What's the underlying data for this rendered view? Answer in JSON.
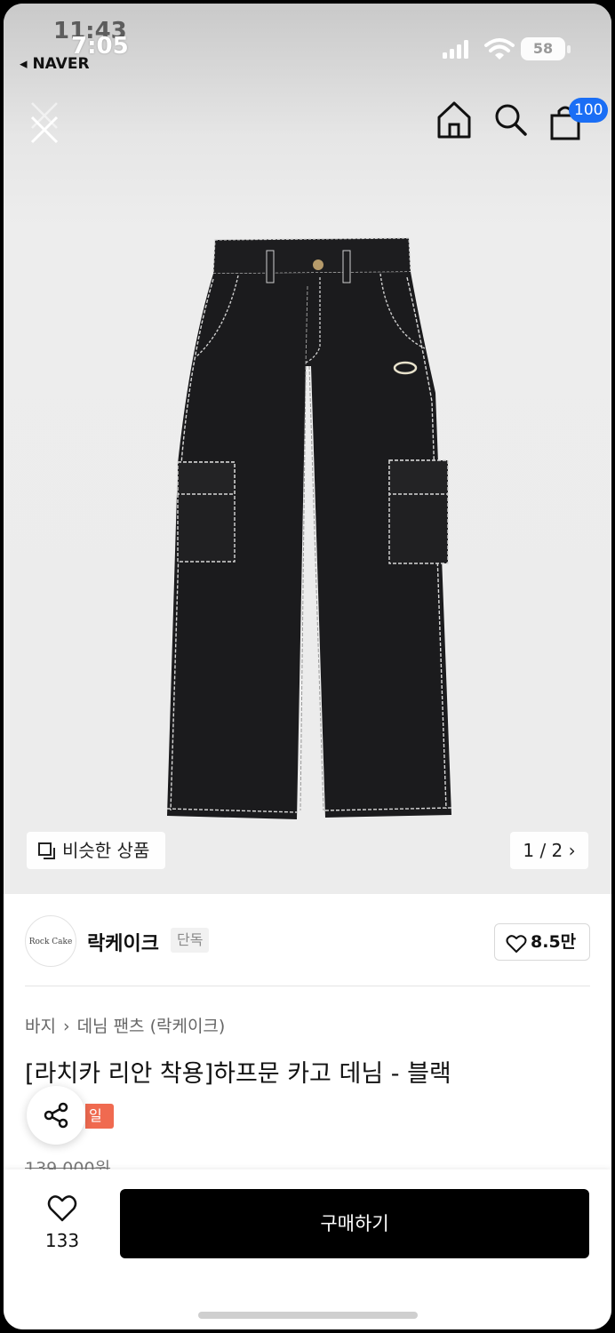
{
  "status_bar": {
    "time_ghost": "11:43",
    "time": "7:05",
    "back_app": "◂ NAVER",
    "battery": "58"
  },
  "header": {
    "cart_badge": "100"
  },
  "image": {
    "similar_label": "비슷한 상품",
    "counter": "1 / 2 ›"
  },
  "brand": {
    "logo_text": "Rock Cake",
    "name": "락케이크",
    "exclusive_badge": "단독",
    "like_count": "8.5만"
  },
  "product": {
    "breadcrumb": [
      "바지",
      "데님 팬츠 (락케이크)"
    ],
    "breadcrumb_separator": "›",
    "title": "[라치카 리안 착용]하프문 카고 데님 - 블랙",
    "sale_badge": "일",
    "original_price": "139,000원"
  },
  "bottom_bar": {
    "wish_count": "133",
    "buy_label": "구매하기"
  },
  "colors": {
    "cart_badge": "#1a6ef5",
    "buy_button": "#000000",
    "sale_badge": "#f06a50"
  },
  "icons": [
    "close-icon",
    "home-icon",
    "search-icon",
    "shopping-bag-icon",
    "similar-products-icon",
    "heart-icon",
    "share-icon"
  ]
}
